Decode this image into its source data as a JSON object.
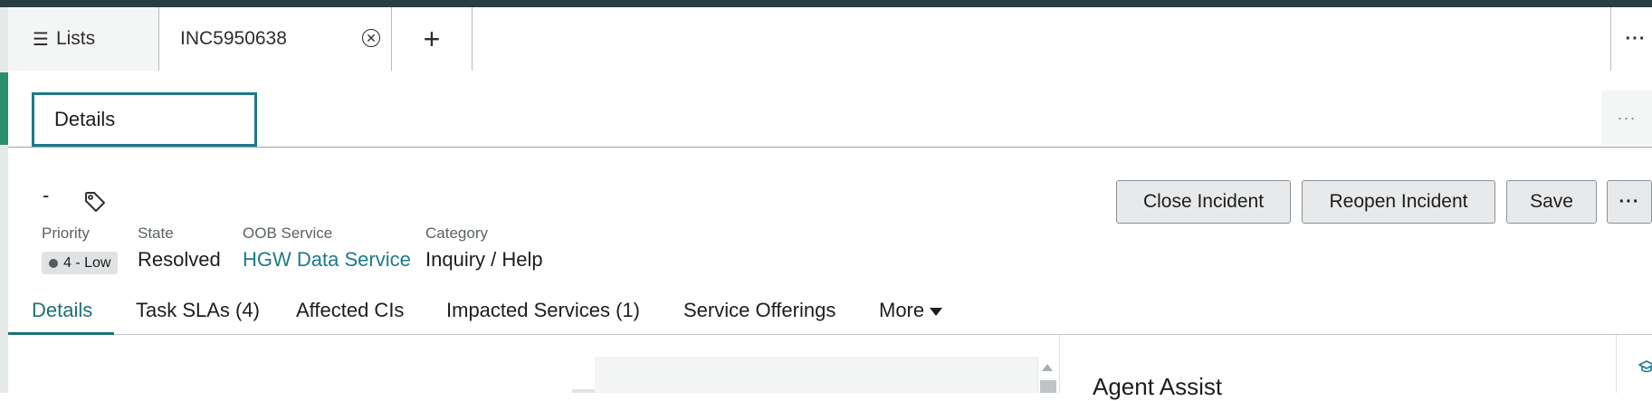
{
  "tabs": {
    "lists_label": "Lists",
    "incident_label": "INC5950638",
    "add_label": "+",
    "more_label": "···"
  },
  "subbar": {
    "details_label": "Details",
    "more_label": "···"
  },
  "record": {
    "dash": "-",
    "priority_label": "Priority",
    "priority_value": "4 - Low",
    "state_label": "State",
    "state_value": "Resolved",
    "service_label": "OOB Service",
    "service_value": "HGW Data Service",
    "category_label": "Category",
    "category_value": "Inquiry / Help"
  },
  "actions": {
    "close_incident": "Close Incident",
    "reopen_incident": "Reopen Incident",
    "save": "Save",
    "more": "···"
  },
  "record_tabs": [
    {
      "label": "Details"
    },
    {
      "label": "Task SLAs (4)"
    },
    {
      "label": "Affected CIs"
    },
    {
      "label": "Impacted Services (1)"
    },
    {
      "label": "Service Offerings"
    },
    {
      "label": "More"
    }
  ],
  "side_panel": {
    "title": "Agent Assist"
  },
  "colors": {
    "accent": "#1d7a8a",
    "topbar": "#293e40",
    "active_tab": "#1d6f77"
  }
}
